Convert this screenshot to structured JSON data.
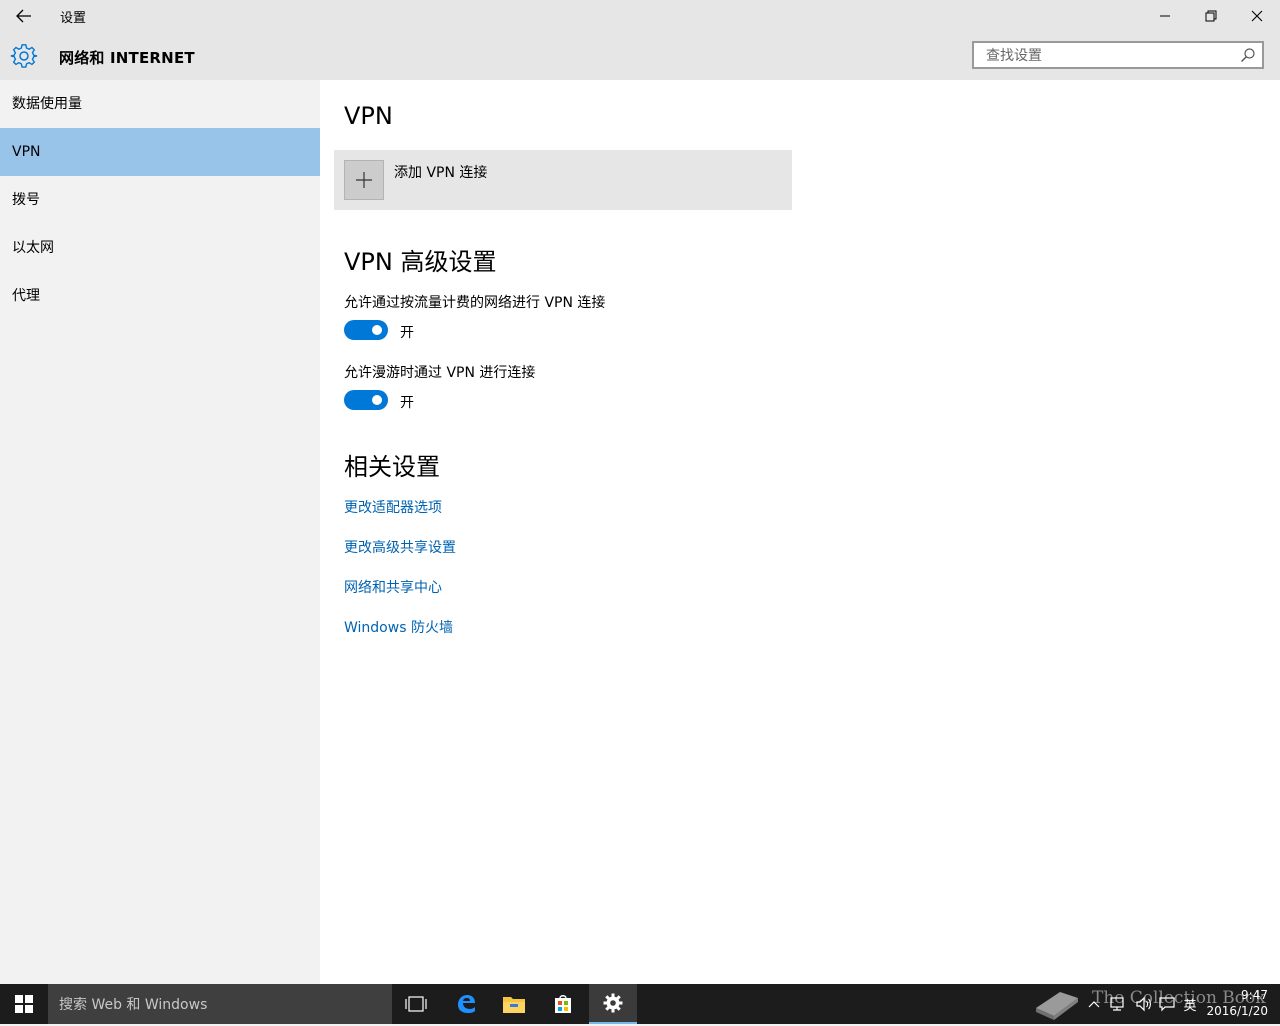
{
  "window": {
    "title": "设置",
    "controls": {
      "minimize": "minimize-icon",
      "restore": "restore-icon",
      "close": "close-icon"
    }
  },
  "header": {
    "section_title": "网络和 INTERNET",
    "search_placeholder": "查找设置"
  },
  "sidebar": {
    "items": [
      {
        "label": "数据使用量",
        "active": false
      },
      {
        "label": "VPN",
        "active": true
      },
      {
        "label": "拨号",
        "active": false
      },
      {
        "label": "以太网",
        "active": false
      },
      {
        "label": "代理",
        "active": false
      }
    ]
  },
  "main": {
    "vpn_heading": "VPN",
    "add_vpn_label": "添加 VPN 连接",
    "advanced_heading": "VPN 高级设置",
    "toggles": [
      {
        "label": "允许通过按流量计费的网络进行 VPN 连接",
        "state": "开",
        "on": true
      },
      {
        "label": "允许漫游时通过 VPN 进行连接",
        "state": "开",
        "on": true
      }
    ],
    "related_heading": "相关设置",
    "related_links": [
      "更改适配器选项",
      "更改高级共享设置",
      "网络和共享中心",
      "Windows 防火墙"
    ]
  },
  "taskbar": {
    "search_placeholder": "搜索 Web 和 Windows",
    "apps": [
      "task-view-icon",
      "edge-icon",
      "file-explorer-icon",
      "store-icon",
      "settings-icon"
    ],
    "active_app": "settings-icon",
    "tray": {
      "input_method": "英",
      "time": "9:47",
      "date": "2016/1/20"
    },
    "watermark": "The Collection Book"
  },
  "colors": {
    "accent": "#0078d7",
    "link": "#0063b1",
    "sidebar_selected": "#99c4e9",
    "chrome": "#e6e6e6",
    "taskbar": "#1c1c1c"
  }
}
